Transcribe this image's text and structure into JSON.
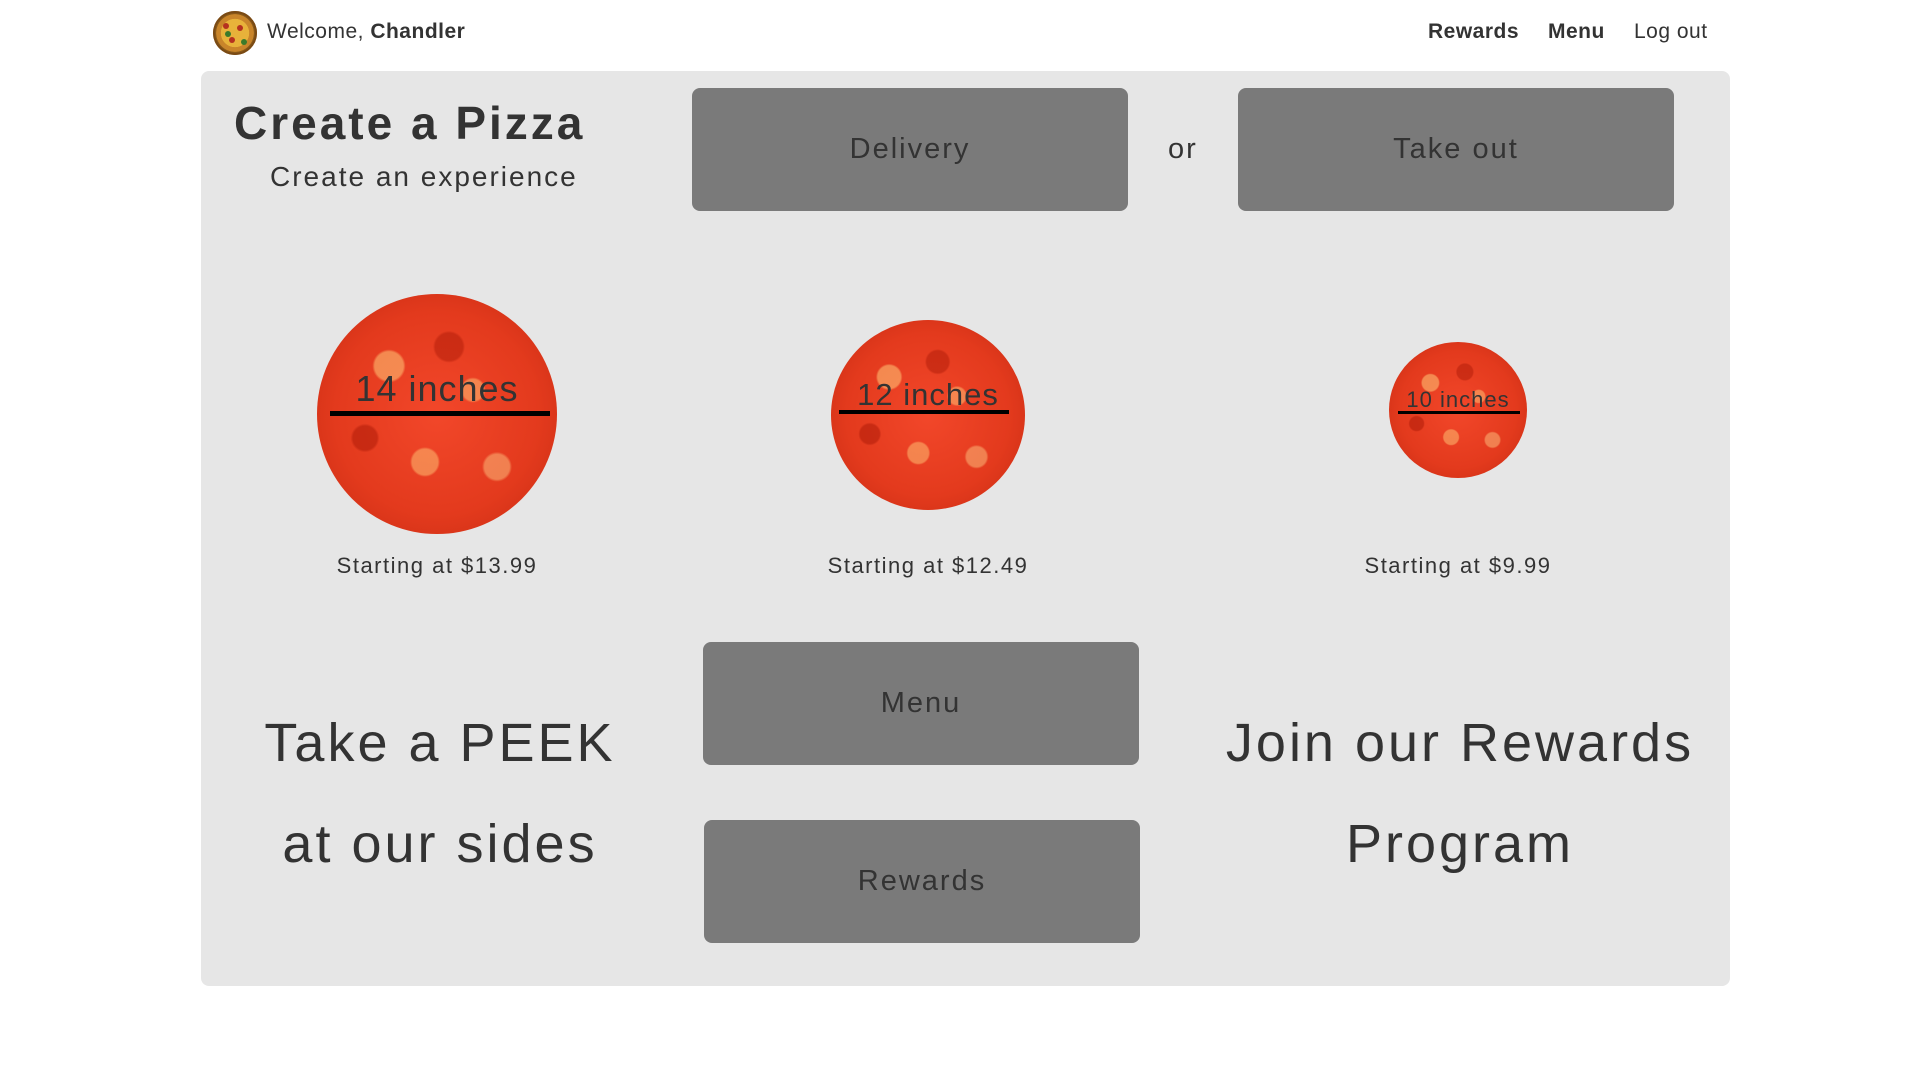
{
  "header": {
    "welcome_prefix": "Welcome, ",
    "user_name": "Chandler",
    "nav": {
      "rewards": "Rewards",
      "menu": "Menu",
      "logout": "Log out"
    }
  },
  "hero": {
    "title": "Create a Pizza",
    "subtitle": "Create an experience",
    "delivery_label": "Delivery",
    "or_label": "or",
    "takeout_label": "Take out"
  },
  "pizzas": [
    {
      "size": "14 inches",
      "price": "Starting at $13.99"
    },
    {
      "size": "12 inches",
      "price": "Starting at $12.49"
    },
    {
      "size": "10 inches",
      "price": "Starting at $9.99"
    }
  ],
  "promo": {
    "peek_line1": "Take a PEEK",
    "peek_line2": "at our sides",
    "menu_button": "Menu",
    "rewards_button": "Rewards",
    "join_line1": "Join our Rewards",
    "join_line2": "Program"
  },
  "colors": {
    "panel": "#e6e6e6",
    "button": "#7a7a7a",
    "text": "#333333"
  }
}
